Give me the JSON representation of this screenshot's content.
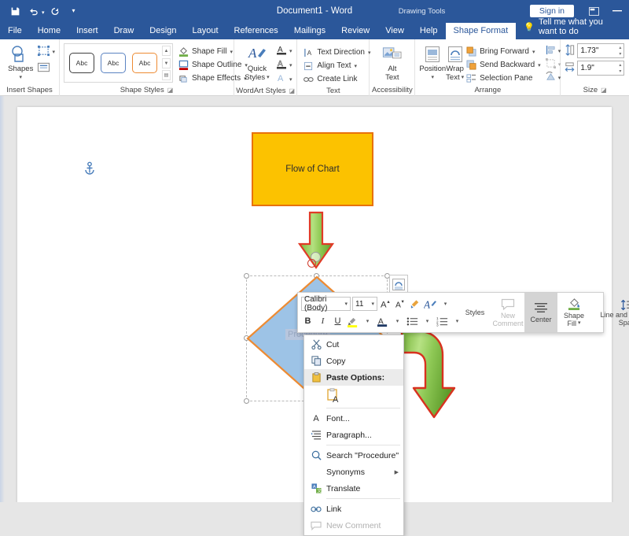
{
  "titlebar": {
    "doc_title": "Document1  -  Word",
    "contextual_tab_group": "Drawing Tools",
    "signin_label": "Sign in",
    "qat": [
      {
        "name": "save-icon",
        "label": "Save"
      },
      {
        "name": "undo-icon",
        "label": "Undo"
      },
      {
        "name": "redo-icon",
        "label": "Redo"
      },
      {
        "name": "customize-qat-icon",
        "label": "Customize Quick Access Toolbar"
      }
    ],
    "window_controls": [
      {
        "name": "ribbon-display-options-icon",
        "label": "Ribbon Display Options"
      },
      {
        "name": "minimize-icon",
        "label": "Minimize"
      }
    ]
  },
  "tabs": [
    {
      "label": "File",
      "active": false
    },
    {
      "label": "Home",
      "active": false
    },
    {
      "label": "Insert",
      "active": false
    },
    {
      "label": "Draw",
      "active": false
    },
    {
      "label": "Design",
      "active": false
    },
    {
      "label": "Layout",
      "active": false
    },
    {
      "label": "References",
      "active": false
    },
    {
      "label": "Mailings",
      "active": false
    },
    {
      "label": "Review",
      "active": false
    },
    {
      "label": "View",
      "active": false
    },
    {
      "label": "Help",
      "active": false
    },
    {
      "label": "Shape Format",
      "active": true
    }
  ],
  "tellme": {
    "placeholder": "Tell me what you want to do",
    "icon": "lightbulb-icon"
  },
  "ribbon": {
    "groups": [
      {
        "label": "Insert Shapes",
        "dialog_launcher": false
      },
      {
        "label": "Shape Styles",
        "dialog_launcher": true
      },
      {
        "label": "WordArt Styles",
        "dialog_launcher": true
      },
      {
        "label": "Text",
        "dialog_launcher": false
      },
      {
        "label": "Accessibility",
        "dialog_launcher": false
      },
      {
        "label": "Arrange",
        "dialog_launcher": false
      },
      {
        "label": "Size",
        "dialog_launcher": true
      }
    ],
    "insert_shapes": {
      "shapes_label": "Shapes",
      "edit_shape_name": "edit-shape-icon",
      "text_box_name": "text-box-icon"
    },
    "shape_styles": {
      "thumbnails": [
        {
          "label": "Abc",
          "outline": "#3f3f3f"
        },
        {
          "label": "Abc",
          "outline": "#5b83c2"
        },
        {
          "label": "Abc",
          "outline": "#ed8b33"
        }
      ],
      "commands": [
        {
          "label": "Shape Fill",
          "icon": "shape-fill-icon",
          "has_caret": true
        },
        {
          "label": "Shape Outline",
          "icon": "shape-outline-icon",
          "has_caret": true
        },
        {
          "label": "Shape Effects",
          "icon": "shape-effects-icon",
          "has_caret": true
        }
      ]
    },
    "wordart_styles": {
      "quick_styles_label": "Quick\nStyles",
      "quick_styles_line1": "Quick",
      "quick_styles_line2": "Styles",
      "commands": [
        {
          "icon": "text-fill-icon",
          "has_caret": true
        },
        {
          "icon": "text-outline-icon",
          "has_caret": true
        },
        {
          "icon": "text-effects-icon",
          "has_caret": true
        }
      ]
    },
    "text": {
      "commands": [
        {
          "label": "Text Direction",
          "icon": "text-direction-icon",
          "has_caret": true
        },
        {
          "label": "Align Text",
          "icon": "align-text-icon",
          "has_caret": true
        },
        {
          "label": "Create Link",
          "icon": "create-link-icon",
          "has_caret": false
        }
      ]
    },
    "accessibility": {
      "alt_text_line1": "Alt",
      "alt_text_line2": "Text",
      "icon": "alt-text-icon"
    },
    "arrange": {
      "position_label": "Position",
      "wrap_text_line1": "Wrap",
      "wrap_text_line2": "Text",
      "commands": [
        {
          "label": "Bring Forward",
          "icon": "bring-forward-icon",
          "has_caret": true
        },
        {
          "label": "Send Backward",
          "icon": "send-backward-icon",
          "has_caret": true
        },
        {
          "label": "Selection Pane",
          "icon": "selection-pane-icon",
          "has_caret": false
        }
      ],
      "align_icon": "align-objects-icon",
      "group_icon": "group-objects-icon",
      "rotate_icon": "rotate-objects-icon"
    },
    "size": {
      "height_value": "1.73\"",
      "width_value": "1.9\"",
      "height_icon": "shape-height-icon",
      "width_icon": "shape-width-icon"
    }
  },
  "document": {
    "anchor_icon": "anchor-icon",
    "shapes": [
      {
        "name": "flow-of-chart-rectangle",
        "text": "Flow of Chart",
        "fill": "#fcc200",
        "outline": "#e8720c"
      },
      {
        "name": "down-arrow-shape",
        "text": "",
        "fill": "#92d050",
        "outline": "#e03a26"
      },
      {
        "name": "procedure-diamond",
        "text": "Procedure",
        "fill": "#9dc3e6",
        "outline": "#ed8b33"
      },
      {
        "name": "bent-arrow-shape",
        "text": "",
        "fill": "#92d050",
        "outline": "#e03a26"
      }
    ],
    "layout_options_icon": "layout-options-icon",
    "rotate_handle_icon": "rotate-handle-icon"
  },
  "mini_toolbar": {
    "font_name": "Calibri (Body)",
    "font_size": "11",
    "row1": [
      {
        "label": "A",
        "name": "grow-font-button"
      },
      {
        "label": "A",
        "name": "shrink-font-button"
      },
      {
        "label": "",
        "name": "format-painter-button"
      }
    ],
    "row2": [
      {
        "label": "B",
        "name": "bold-button"
      },
      {
        "label": "I",
        "name": "italic-button"
      },
      {
        "label": "U",
        "name": "underline-button"
      },
      {
        "label": "",
        "name": "text-highlight-color-button"
      },
      {
        "label": "A",
        "name": "font-color-button"
      },
      {
        "label": "",
        "name": "bullets-button"
      },
      {
        "label": "",
        "name": "numbering-button"
      }
    ],
    "styles_label": "Styles",
    "new_comment_line1": "New",
    "new_comment_line2": "Comment",
    "center_label": "Center",
    "shape_fill_line1": "Shape",
    "shape_fill_line2": "Fill",
    "line_spacing_line1": "Line and Paragraph",
    "line_spacing_line2": "Spacing"
  },
  "context_menu": {
    "items": [
      {
        "label": "Cut",
        "icon": "cut-icon",
        "state": "normal",
        "submenu": false,
        "underline_index": 2
      },
      {
        "label": "Copy",
        "icon": "copy-icon",
        "state": "normal",
        "submenu": false
      },
      {
        "label": "Paste Options:",
        "icon": "paste-icon",
        "state": "highlighted",
        "submenu": false
      },
      {
        "label": "",
        "icon": "keep-text-only-icon",
        "state": "paste-thumb",
        "submenu": false
      },
      {
        "label": "Font...",
        "icon": "font-icon",
        "state": "normal",
        "submenu": false
      },
      {
        "label": "Paragraph...",
        "icon": "paragraph-icon",
        "state": "normal",
        "submenu": false
      },
      {
        "label": "Search \"Procedure\"",
        "icon": "search-icon",
        "state": "normal",
        "submenu": false
      },
      {
        "label": "Synonyms",
        "icon": "",
        "state": "normal",
        "submenu": true
      },
      {
        "label": "Translate",
        "icon": "translate-icon",
        "state": "normal",
        "submenu": false
      },
      {
        "label": "Link",
        "icon": "link-icon",
        "state": "normal",
        "submenu": false
      },
      {
        "label": "New Comment",
        "icon": "new-comment-icon",
        "state": "disabled",
        "submenu": false
      }
    ]
  },
  "colors": {
    "accent": "#2b579a",
    "shape_yellow": "#fcc200",
    "shape_orange": "#e8720c",
    "shape_blue": "#9dc3e6",
    "arrow_green": "#92d050",
    "arrow_red": "#e03a26"
  }
}
